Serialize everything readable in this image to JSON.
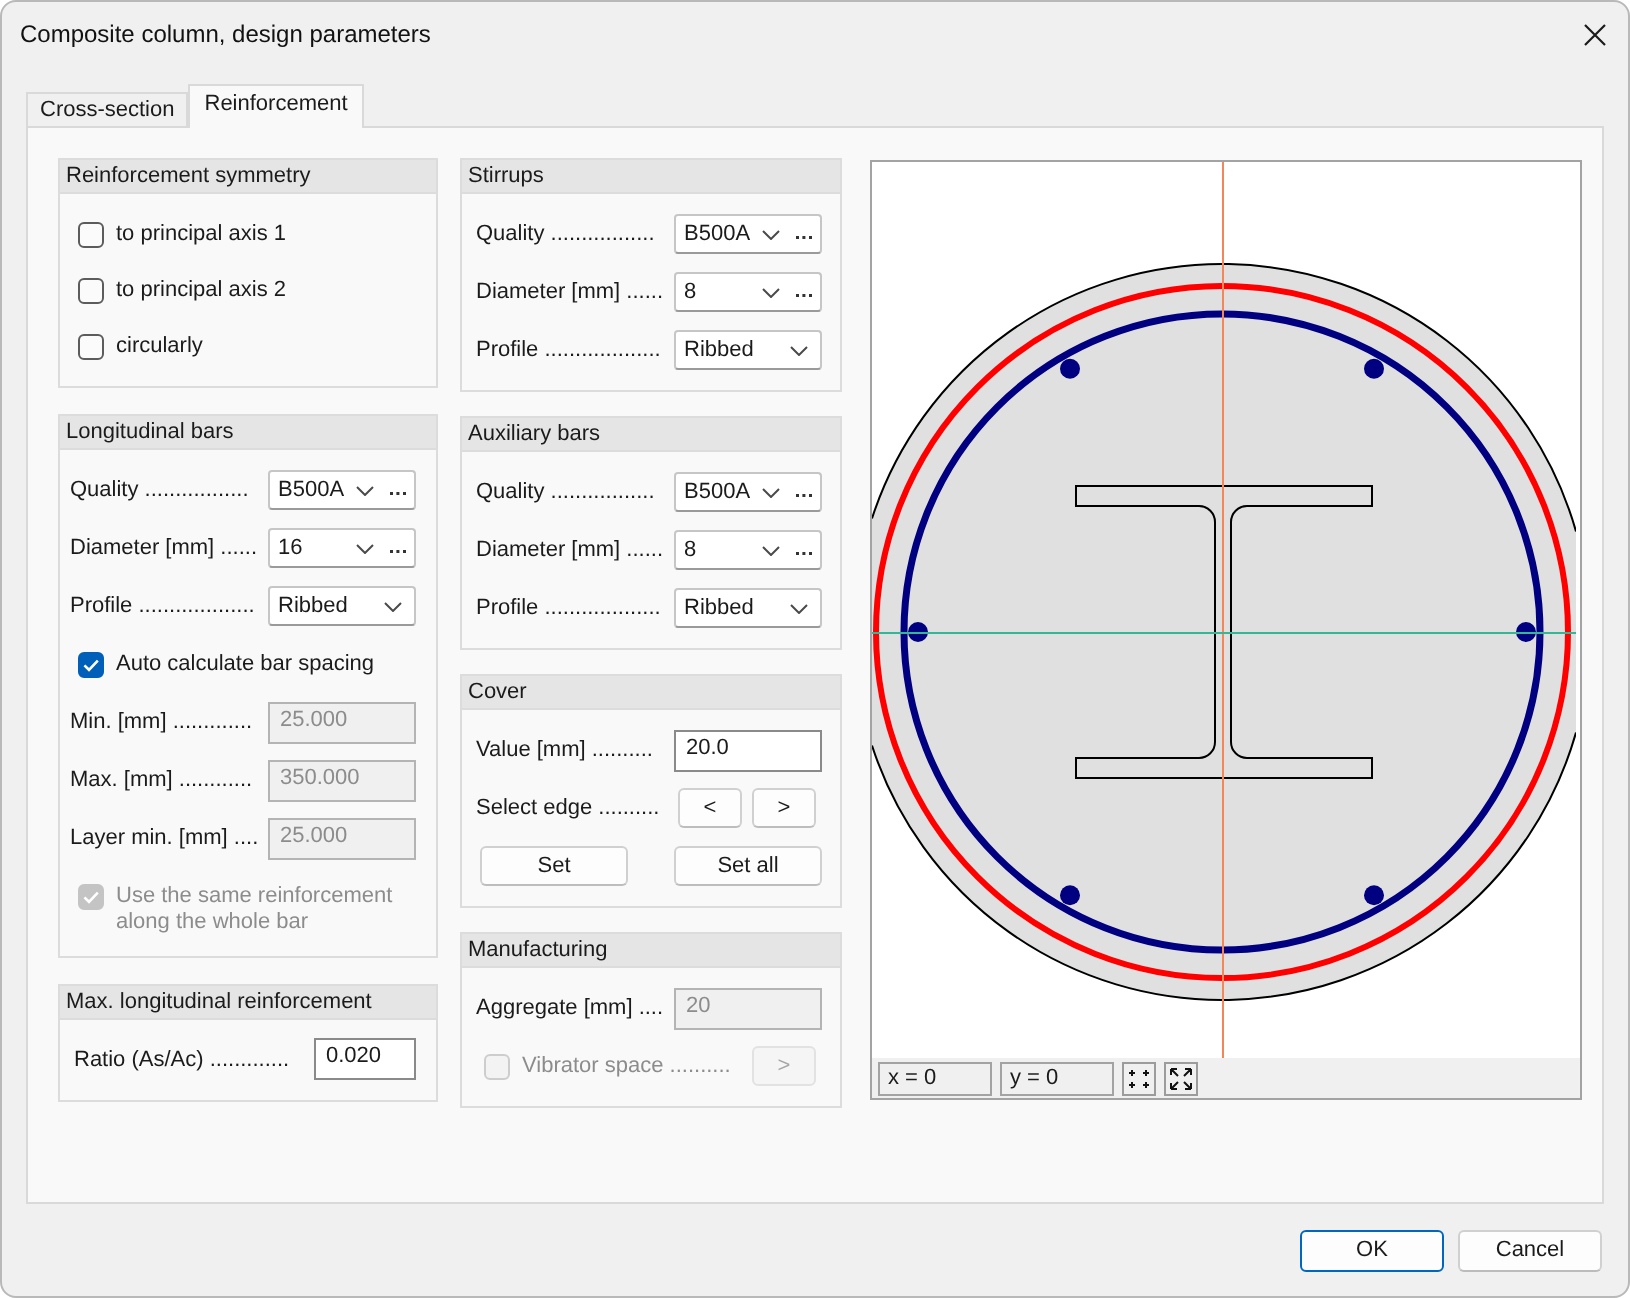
{
  "window": {
    "title": "Composite column, design parameters"
  },
  "tabs": [
    {
      "label": "Cross-section",
      "selected": false
    },
    {
      "label": "Reinforcement",
      "selected": true
    }
  ],
  "left_column": [
    {
      "title": "Reinforcement symmetry",
      "rows": [
        {
          "kind": "checkbox",
          "label": "to principal axis 1",
          "checked": false,
          "disabled": false
        },
        {
          "kind": "checkbox",
          "label": "to principal axis 2",
          "checked": false,
          "disabled": false
        },
        {
          "kind": "checkbox",
          "label": "circularly",
          "checked": false,
          "disabled": false
        }
      ]
    },
    {
      "title": "Longitudinal bars",
      "rows": [
        {
          "kind": "select",
          "label": "Quality .................",
          "value": "B500A",
          "browse": true,
          "disabled": false
        },
        {
          "kind": "select",
          "label": "Diameter [mm] ......",
          "value": "16",
          "browse": true,
          "disabled": false
        },
        {
          "kind": "select",
          "label": "Profile ...................",
          "value": "Ribbed",
          "browse": false,
          "disabled": false
        },
        {
          "kind": "checkbox",
          "label": "Auto calculate bar spacing",
          "checked": true,
          "disabled": false
        },
        {
          "kind": "input",
          "label": "Min. [mm] .............",
          "value": "25.000",
          "disabled": true
        },
        {
          "kind": "input",
          "label": "Max. [mm] ............",
          "value": "350.000",
          "disabled": true
        },
        {
          "kind": "input",
          "label": "Layer min. [mm] ....",
          "value": "25.000",
          "disabled": true
        },
        {
          "kind": "checkbox",
          "label": "Use the same reinforcement along the whole bar",
          "checked": true,
          "disabled": true
        }
      ]
    },
    {
      "title": "Max. longitudinal reinforcement",
      "rows": [
        {
          "kind": "input",
          "label": "Ratio (As/Ac) .............",
          "value": "0.020",
          "disabled": false
        }
      ]
    }
  ],
  "middle_column": [
    {
      "title": "Stirrups",
      "rows": [
        {
          "kind": "select",
          "label": "Quality .................",
          "value": "B500A",
          "browse": true,
          "disabled": false
        },
        {
          "kind": "select",
          "label": "Diameter [mm] ......",
          "value": "8",
          "browse": true,
          "disabled": false
        },
        {
          "kind": "select",
          "label": "Profile ...................",
          "value": "Ribbed",
          "browse": false,
          "disabled": false
        }
      ]
    },
    {
      "title": "Auxiliary bars",
      "rows": [
        {
          "kind": "select",
          "label": "Quality .................",
          "value": "B500A",
          "browse": true,
          "disabled": false
        },
        {
          "kind": "select",
          "label": "Diameter [mm] ......",
          "value": "8",
          "browse": true,
          "disabled": false
        },
        {
          "kind": "select",
          "label": "Profile ...................",
          "value": "Ribbed",
          "browse": false,
          "disabled": false
        }
      ]
    },
    {
      "title": "Cover",
      "rows": [
        {
          "kind": "input",
          "label": "Value [mm] ..........",
          "value": "20.0",
          "disabled": false
        },
        {
          "kind": "buttons",
          "label": "Select edge ..........",
          "buttons": [
            {
              "label": "<",
              "disabled": false
            },
            {
              "label": ">",
              "disabled": false
            }
          ]
        },
        {
          "kind": "buttons",
          "buttons": [
            {
              "label": "Set",
              "disabled": false
            },
            {
              "label": "Set all",
              "disabled": false
            }
          ]
        }
      ]
    },
    {
      "title": "Manufacturing",
      "rows": [
        {
          "kind": "input",
          "label": "Aggregate [mm] ....",
          "value": "20",
          "disabled": true
        },
        {
          "kind": "checkbox",
          "label": "Vibrator space ..........",
          "checked": false,
          "disabled": true,
          "button": {
            "label": ">",
            "disabled": true
          }
        }
      ]
    }
  ],
  "preview": {
    "readouts": [
      "x = 0",
      "y = 0"
    ]
  },
  "buttons": [
    {
      "label": "OK",
      "default": true
    },
    {
      "label": "Cancel",
      "default": false
    }
  ]
}
